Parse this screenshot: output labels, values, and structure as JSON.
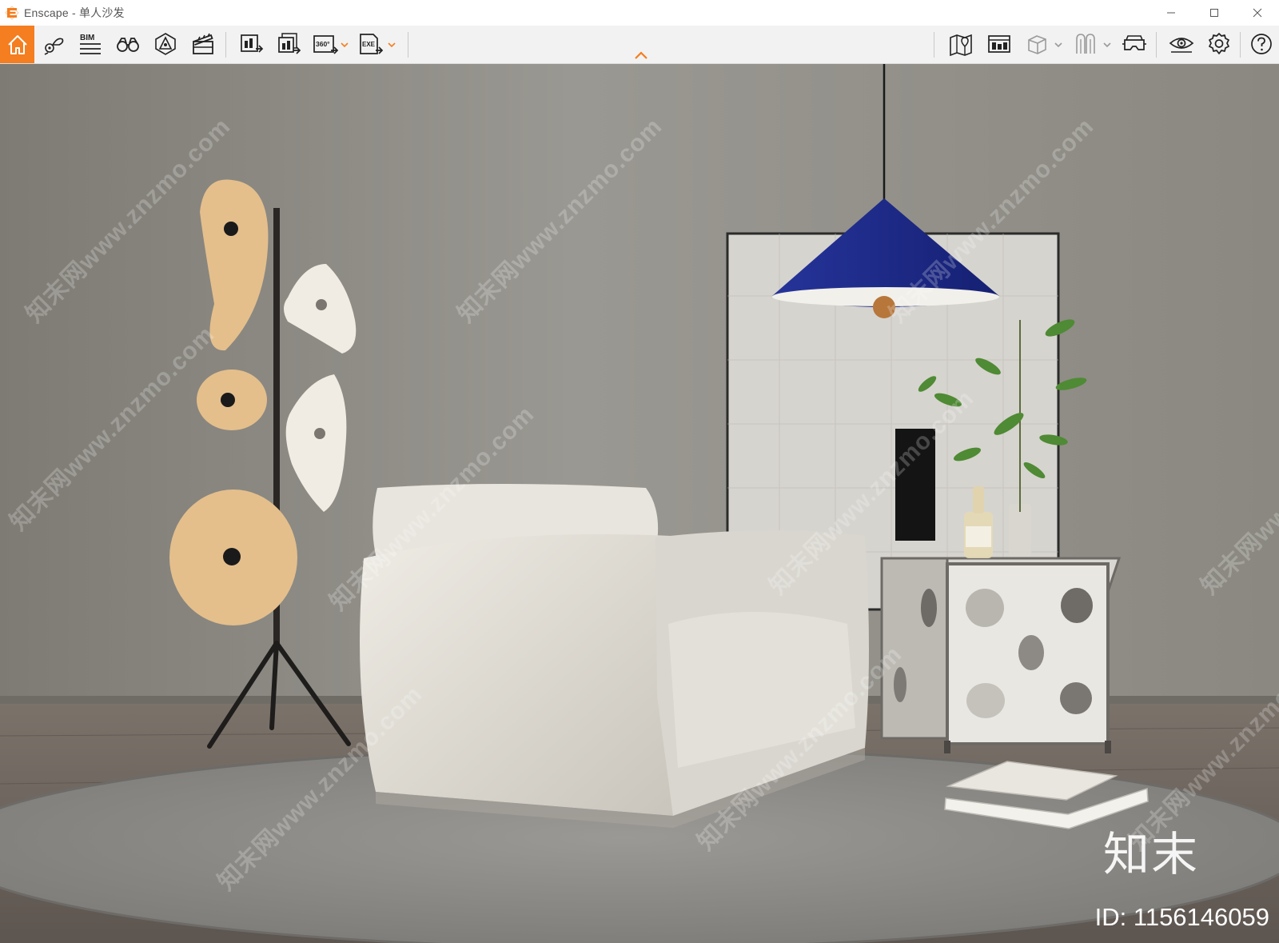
{
  "window": {
    "app_name": "Enscape",
    "separator": " - ",
    "document_name": "单人沙发",
    "accent_color": "#f47e20"
  },
  "toolbar": {
    "left_buttons": [
      {
        "icon": "home-icon",
        "active": true
      },
      {
        "icon": "view-management-icon"
      },
      {
        "icon": "bim-icon",
        "label": "BIM"
      },
      {
        "icon": "binoculars-icon"
      },
      {
        "icon": "asset-library-icon"
      },
      {
        "icon": "video-editor-icon"
      },
      {
        "icon": "render-screenshot-icon"
      },
      {
        "icon": "batch-render-icon"
      },
      {
        "icon": "panorama-360-icon",
        "label": "360°"
      },
      {
        "icon": "export-exe-icon",
        "label": "EXE"
      }
    ],
    "right_buttons": [
      {
        "icon": "map-icon"
      },
      {
        "icon": "atlas-icon"
      },
      {
        "icon": "section-box-icon"
      },
      {
        "icon": "collaborate-icon"
      },
      {
        "icon": "vr-headset-icon"
      },
      {
        "icon": "visual-settings-eye-icon"
      },
      {
        "icon": "settings-gear-icon"
      },
      {
        "icon": "help-icon"
      }
    ]
  },
  "viewport": {
    "watermark_text": "知末网www.znzmo.com",
    "brand_mark": "知末",
    "id_label": "ID: 1156146059",
    "colors": {
      "wall": "#8f8d87",
      "floor": "#6a625b",
      "rug": "#8a8884",
      "sofa": "#e3e0d9",
      "pendant_shade": "#1e2d8a",
      "lamp_disc": "#e4bf8c",
      "lamp_disc_light": "#f1ece3"
    }
  }
}
